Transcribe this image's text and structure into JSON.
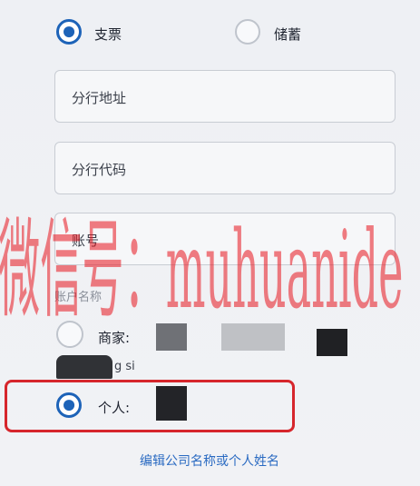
{
  "account_type": {
    "options": [
      {
        "label": "支票",
        "selected": true
      },
      {
        "label": "储蓄",
        "selected": false
      }
    ]
  },
  "fields": {
    "branch_address": {
      "placeholder": "分行地址"
    },
    "branch_code": {
      "placeholder": "分行代码"
    },
    "account_number": {
      "placeholder": "账号"
    }
  },
  "account_name": {
    "section_label": "账户名称",
    "merchant_label": "商家:",
    "merchant_partial_text": "g si",
    "individual_label": "个人:",
    "merchant_selected": false,
    "individual_selected": true
  },
  "edit_link": "编辑公司名称或个人姓名",
  "watermark": "微信号：muhuanide",
  "colors": {
    "accent": "#1d63b8",
    "highlight": "#d6262c",
    "link": "#2b6bc2",
    "watermark": "#e8141e"
  }
}
